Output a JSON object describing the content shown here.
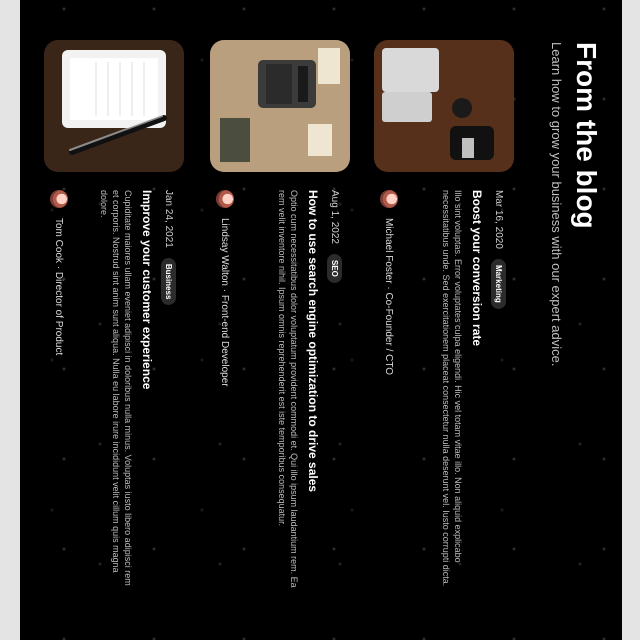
{
  "page": {
    "title": "From the blog",
    "subtitle": "Learn how to grow your business with our expert advice."
  },
  "posts": [
    {
      "date": "Mar 16, 2020",
      "category": "Marketing",
      "title": "Boost your conversion rate",
      "excerpt": "Illo sint voluptas. Error voluptates culpa eligendi. Hic vel totam vitae illo. Non aliquid explicabo necessitatibus unde. Sed exercitationem placeat consectetur nulla deserunt vel. Iusto corrupti dicta.",
      "author": "Michael Foster · Co-Founder / CTO"
    },
    {
      "date": "Aug 1, 2022",
      "category": "SEO",
      "title": "How to use search engine optimization to drive sales",
      "excerpt": "Optio cum necessitatibus dolor voluptatum provident commodi et. Qui illo ipsum laudantium rem. Ea rem velit inventore nihil. Ipsum omnis reprehenderit est iste temporibus consequatur.",
      "author": "Lindsay Walton · Front-end Developer"
    },
    {
      "date": "Jan 24, 2021",
      "category": "Business",
      "title": "Improve your customer experience",
      "excerpt": "Cupiditate maiores ullam eveniet adipisci in doloribus nulla minus. Voluptas iusto libero adipisci rem et corporis. Nostrud sint anim sunt aliqua. Nulla eu labore irure incididunt velit cillum quis magna dolore.",
      "author": "Tom Cook · Director of Product"
    }
  ]
}
